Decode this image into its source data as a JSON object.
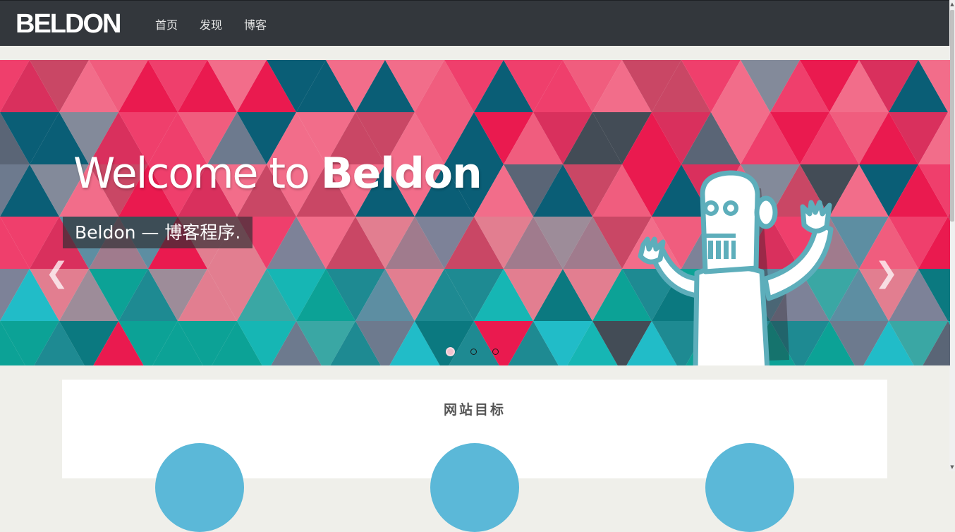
{
  "nav": {
    "brand": "BELDON",
    "links": [
      "首页",
      "发现",
      "博客"
    ]
  },
  "hero": {
    "title_light": "Welcome to ",
    "title_bold": "Beldon",
    "subtitle": "Beldon — 博客程序.",
    "prev_icon": "chevron-left-icon",
    "next_icon": "chevron-right-icon",
    "slide_count": 3,
    "active_slide": 1
  },
  "goals": {
    "title": "网站目标",
    "circle_color": "#5bb8d8"
  },
  "colors": {
    "navbar": "#33373c",
    "page_bg": "#efefea",
    "hero_pink": "#ea1a4f",
    "hero_teal": "#0ca296",
    "hero_dark": "#434c56",
    "robot_outline": "#5daebb"
  }
}
